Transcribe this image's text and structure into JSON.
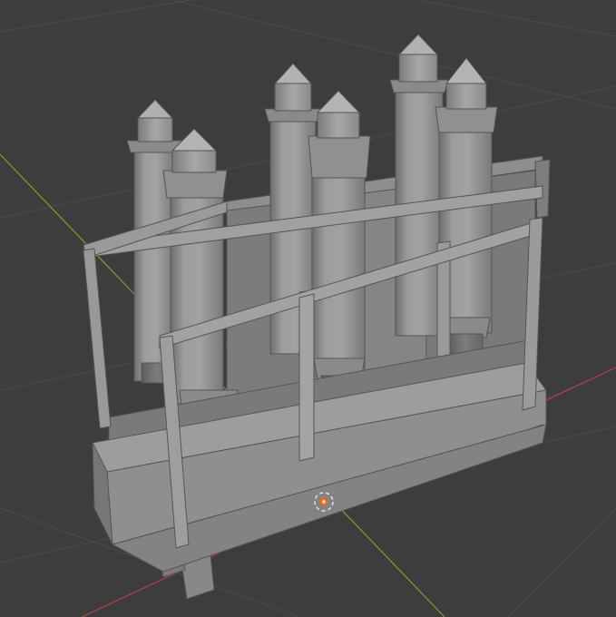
{
  "viewport": {
    "background_color": "#3d3d3d",
    "grid_line_color": "#4b4b4b",
    "x_axis_color": "#b8404f",
    "y_axis_color": "#7ea032",
    "model_color": "#8c8c8c"
  },
  "scene": {
    "object": "rack-with-six-cylinders",
    "cylinder_count": 6,
    "origin_marker": "world-origin-icon"
  }
}
